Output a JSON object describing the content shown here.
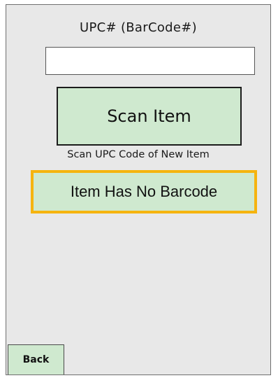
{
  "upc": {
    "label": "UPC# (BarCode#)",
    "value": ""
  },
  "scan": {
    "button_label": "Scan Item",
    "hint": "Scan UPC Code of New Item"
  },
  "no_barcode": {
    "button_label": "Item Has No Barcode"
  },
  "footer": {
    "back_label": "Back"
  },
  "colors": {
    "background": "#e8e8e8",
    "button_fill": "#cfe9cf",
    "highlight_border": "#f5b40f"
  }
}
